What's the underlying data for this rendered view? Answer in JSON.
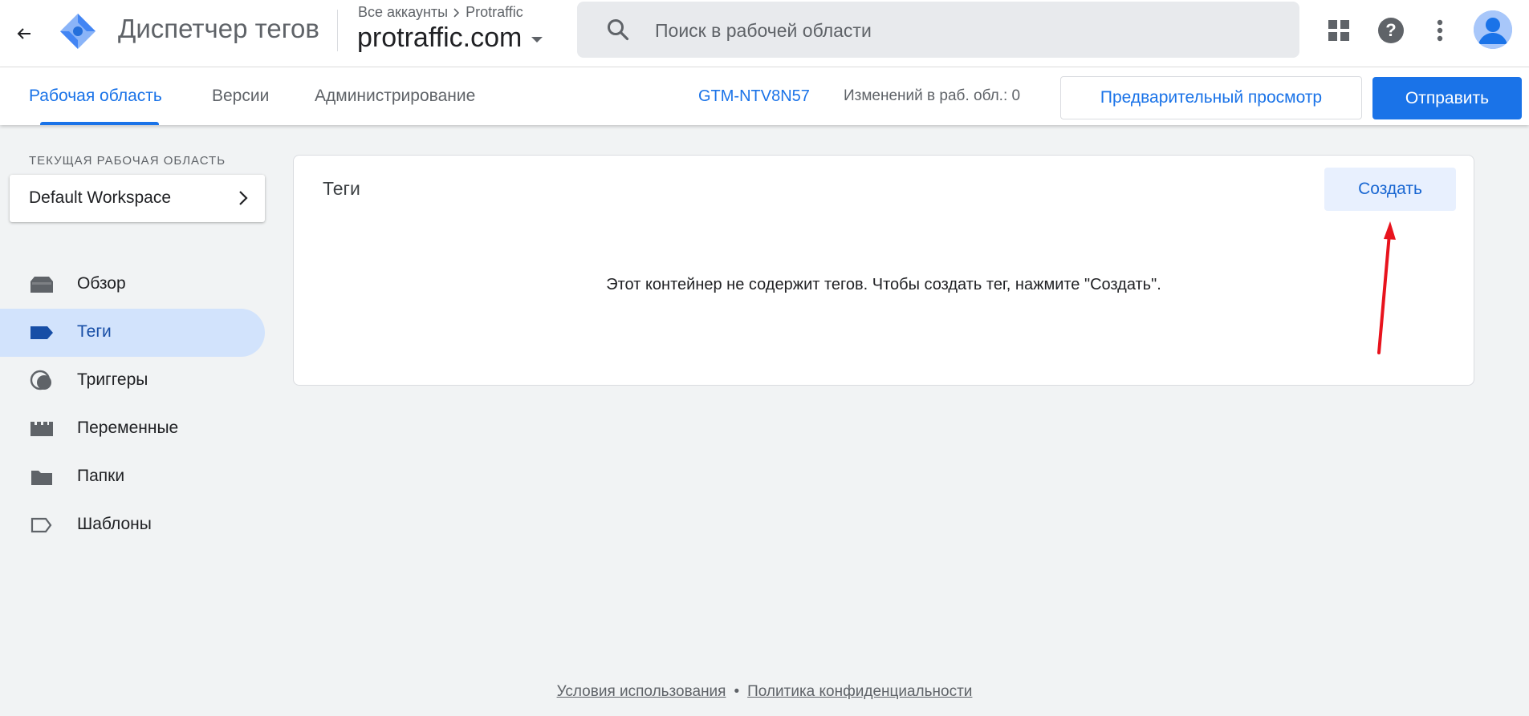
{
  "header": {
    "app_title": "Диспетчер тегов",
    "breadcrumb": {
      "accounts": "Все аккаунты",
      "account": "Protraffic"
    },
    "container": "protraffic.com",
    "search_placeholder": "Поиск в рабочей области"
  },
  "subnav": {
    "tabs": [
      {
        "label": "Рабочая область",
        "active": true
      },
      {
        "label": "Версии",
        "active": false
      },
      {
        "label": "Администрирование",
        "active": false
      }
    ],
    "container_id": "GTM-NTV8N57",
    "changes": "Изменений в раб. обл.: 0",
    "preview_label": "Предварительный просмотр",
    "submit_label": "Отправить"
  },
  "sidebar": {
    "workspace_heading": "ТЕКУЩАЯ РАБОЧАЯ ОБЛАСТЬ",
    "workspace_name": "Default Workspace",
    "items": [
      {
        "label": "Обзор",
        "icon": "overview-icon",
        "active": false
      },
      {
        "label": "Теги",
        "icon": "tag-icon",
        "active": true
      },
      {
        "label": "Триггеры",
        "icon": "trigger-icon",
        "active": false
      },
      {
        "label": "Переменные",
        "icon": "variables-icon",
        "active": false
      },
      {
        "label": "Папки",
        "icon": "folder-icon",
        "active": false
      },
      {
        "label": "Шаблоны",
        "icon": "template-icon",
        "active": false
      }
    ]
  },
  "main": {
    "card_title": "Теги",
    "create_label": "Создать",
    "empty_message": "Этот контейнер не содержит тегов. Чтобы создать тег, нажмите \"Создать\"."
  },
  "footer": {
    "terms": "Условия использования",
    "separator": "•",
    "privacy": "Политика конфиденциальности"
  },
  "colors": {
    "accent": "#1a73e8",
    "active_nav_bg": "#d2e3fc",
    "annotation_arrow": "#e8131d"
  }
}
